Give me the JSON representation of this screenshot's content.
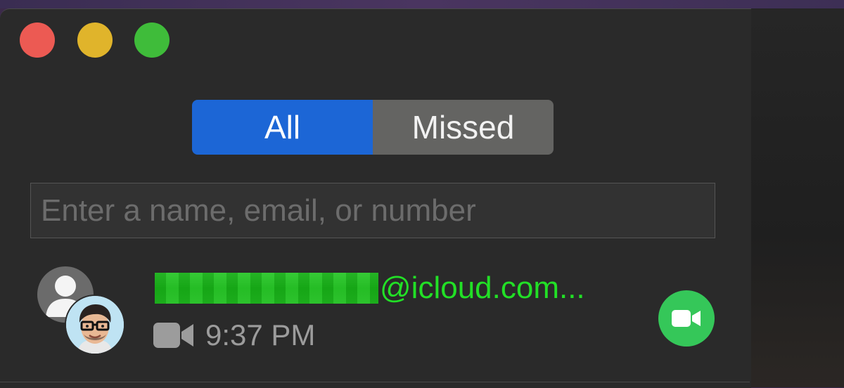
{
  "window": {
    "controls": [
      "close",
      "minimize",
      "maximize"
    ]
  },
  "filter": {
    "tabs": [
      {
        "label": "All",
        "selected": true
      },
      {
        "label": "Missed",
        "selected": false
      }
    ]
  },
  "search": {
    "placeholder": "Enter a name, email, or number",
    "value": ""
  },
  "recents": [
    {
      "contact_display": "@icloud.com...",
      "contact_redacted": true,
      "call_type_icon": "video-camera-icon",
      "time": "9:37 PM",
      "action_icon": "video-camera-icon"
    }
  ],
  "colors": {
    "selected_tab": "#1c66d6",
    "unselected_tab": "#646462",
    "contact_text": "#22e026",
    "video_button": "#35c759",
    "close": "#ec5a53",
    "minimize": "#e0b42b",
    "maximize": "#3fbc3a"
  }
}
